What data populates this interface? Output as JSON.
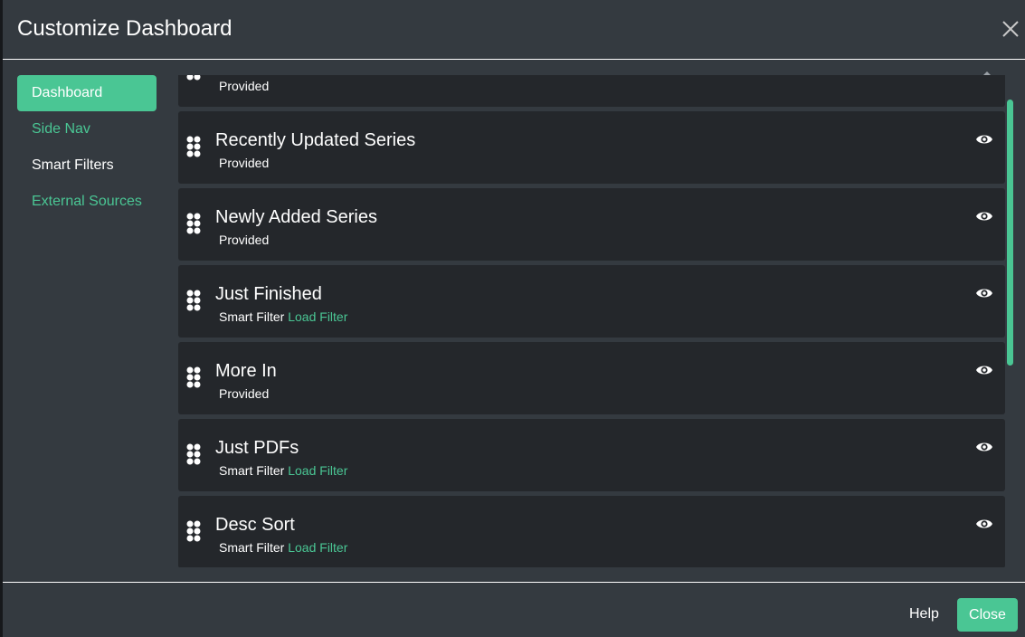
{
  "modal": {
    "title": "Customize Dashboard"
  },
  "sidebar": {
    "items": [
      {
        "label": "Dashboard",
        "state": "active"
      },
      {
        "label": "Side Nav",
        "state": "link"
      },
      {
        "label": "Smart Filters",
        "state": "plain"
      },
      {
        "label": "External Sources",
        "state": "link"
      }
    ]
  },
  "streams": [
    {
      "title": "",
      "type": "Provided",
      "action": ""
    },
    {
      "title": "Recently Updated Series",
      "type": "Provided",
      "action": ""
    },
    {
      "title": "Newly Added Series",
      "type": "Provided",
      "action": ""
    },
    {
      "title": "Just Finished",
      "type": "Smart Filter",
      "action": "Load Filter"
    },
    {
      "title": "More In",
      "type": "Provided",
      "action": ""
    },
    {
      "title": "Just PDFs",
      "type": "Smart Filter",
      "action": "Load Filter"
    },
    {
      "title": "Desc Sort",
      "type": "Smart Filter",
      "action": "Load Filter"
    }
  ],
  "footer": {
    "help_label": "Help",
    "close_label": "Close"
  },
  "icons": {
    "close": "close-icon",
    "drag": "drag-handle-icon",
    "visibility": "eye-icon"
  },
  "colors": {
    "accent": "#4ac694",
    "modal_bg": "#343a40",
    "row_bg": "#24272b"
  }
}
